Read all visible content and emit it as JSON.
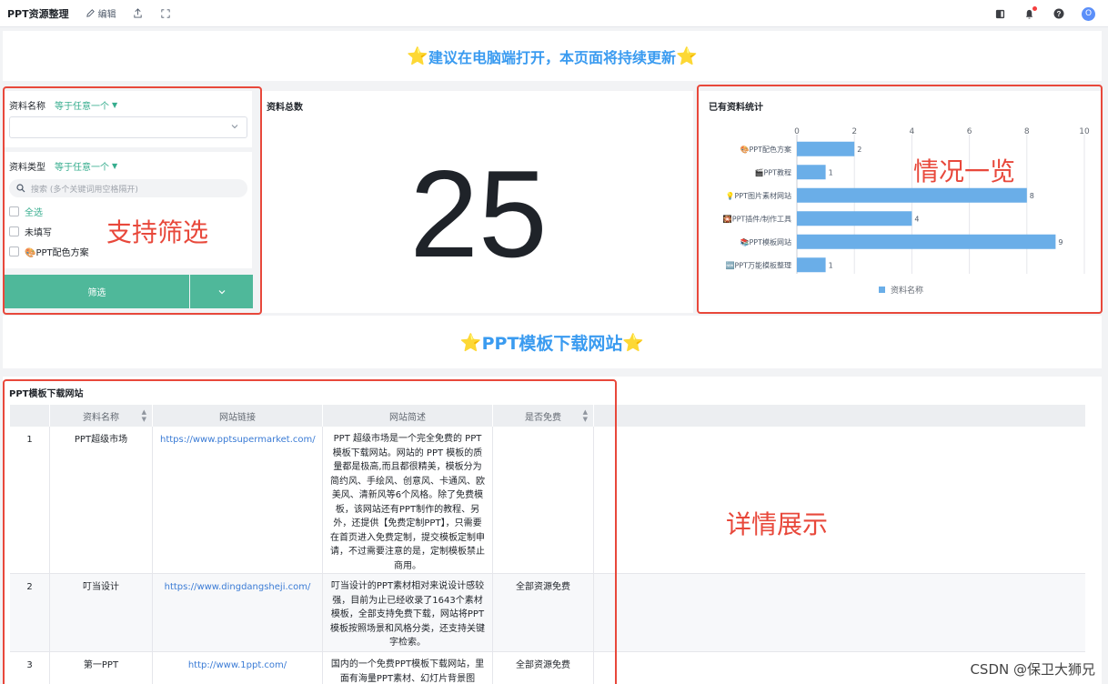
{
  "toolbar": {
    "title": "PPT资源整理",
    "edit_label": "编辑",
    "avatar_initial": "O"
  },
  "banner_top": "建议在电脑端打开，本页面将持续更新",
  "banner_section": "PPT模板下载网站",
  "filter": {
    "name_label": "资料名称",
    "name_condition": "等于任意一个",
    "type_label": "资料类型",
    "type_condition": "等于任意一个",
    "search_placeholder": "搜索 (多个关键词用空格隔开)",
    "options": [
      "全选",
      "未填写",
      "🎨PPT配色方案"
    ],
    "button_label": "筛选"
  },
  "total": {
    "title": "资料总数",
    "value": "25"
  },
  "chart_data": {
    "type": "bar",
    "orientation": "horizontal",
    "title": "已有资料统计",
    "categories": [
      "🎨PPT配色方案",
      "🎬PPT教程",
      "💡PPT图片素材网站",
      "🎇PPT插件/制作工具",
      "📚PPT模板网站",
      "🆕PPT万能模板整理"
    ],
    "series": [
      {
        "name": "资料名称",
        "values": [
          2,
          1,
          8,
          4,
          9,
          1
        ]
      }
    ],
    "xlim": [
      0,
      10
    ],
    "xticks": [
      0,
      2,
      4,
      6,
      8,
      10
    ],
    "axis_position": "top",
    "legend": "bottom",
    "grid": true,
    "color": "#6aaee8"
  },
  "annotations": {
    "filter": "支持筛选",
    "overview": "情况一览",
    "details": "详情展示"
  },
  "table": {
    "title": "PPT模板下载网站",
    "columns": [
      "资料名称",
      "网站链接",
      "网站简述",
      "是否免费"
    ],
    "rows": [
      {
        "idx": "1",
        "name": "PPT超级市场",
        "link": "https://www.pptsupermarket.com/",
        "desc": "PPT 超级市场是一个完全免费的 PPT 模板下载网站。网站的 PPT 模板的质量都是极高,而且都很精美，模板分为简约风、手绘风、创意风、卡通风、欧美风、清新风等6个风格。除了免费模板，该网站还有PPT制作的教程、另外，还提供【免费定制PPT】，只需要在首页进入免费定制，提交模板定制申请，不过需要注意的是，定制模板禁止商用。",
        "free": ""
      },
      {
        "idx": "2",
        "name": "叮当设计",
        "link": "https://www.dingdangsheji.com/",
        "desc": "叮当设计的PPT素材相对来说设计感较强，目前为止已经收录了1643个素材模板，全部支持免费下载，网站将PPT模板按照场景和风格分类，还支持关键字检索。",
        "free": "全部资源免费"
      },
      {
        "idx": "3",
        "name": "第一PPT",
        "link": "http://www.1ppt.com/",
        "desc": "国内的一个免费PPT模板下载网站，里面有海量PPT素材、幻灯片背景图",
        "free": "全部资源免费"
      }
    ]
  },
  "watermark": "CSDN @保卫大狮兄"
}
